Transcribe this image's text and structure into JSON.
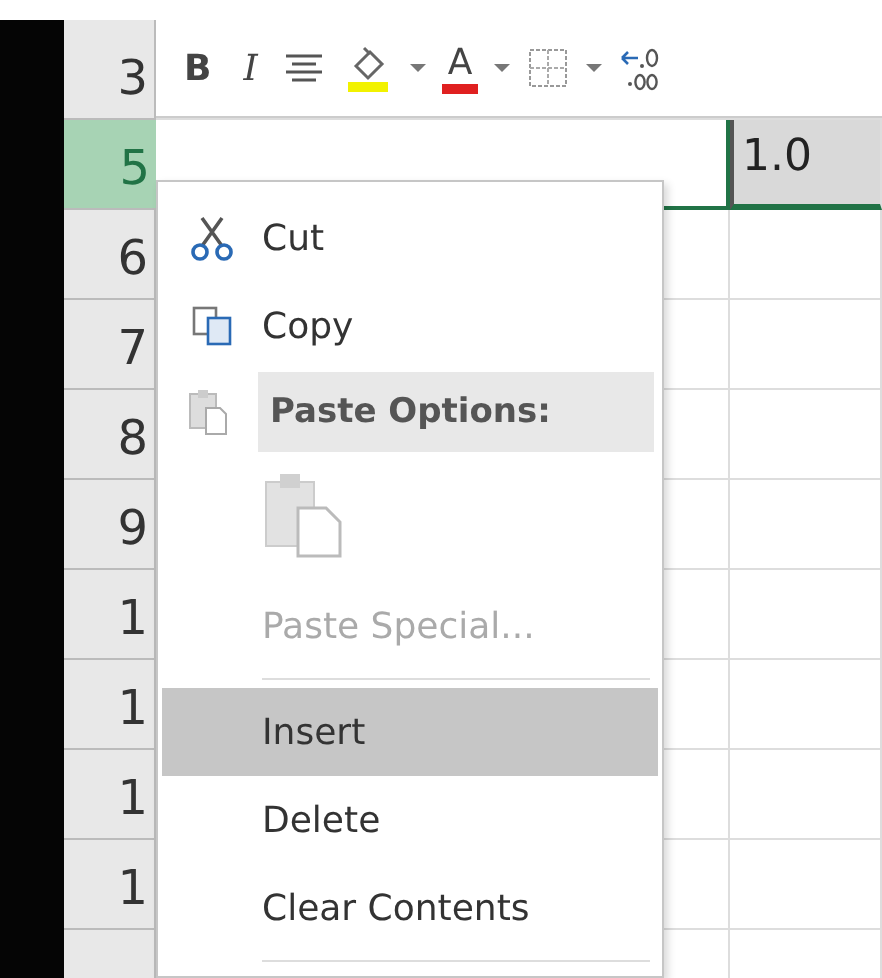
{
  "mini_toolbar": {
    "buttons": [
      {
        "kind": "bold",
        "label": "B"
      },
      {
        "kind": "italic",
        "label": "I"
      },
      {
        "kind": "align"
      },
      {
        "kind": "fill",
        "color": "#f2f200"
      },
      {
        "kind": "dropdown"
      },
      {
        "kind": "font-color",
        "label": "A",
        "color": "#e02020"
      },
      {
        "kind": "dropdown"
      },
      {
        "kind": "borders"
      },
      {
        "kind": "dropdown"
      },
      {
        "kind": "decimal"
      }
    ]
  },
  "rows": [
    {
      "header": "3",
      "selected": false,
      "cells": []
    },
    {
      "header": "5",
      "selected": true,
      "cells": [
        "",
        "1.0"
      ]
    },
    {
      "header": "6",
      "selected": false,
      "cells": []
    },
    {
      "header": "7",
      "selected": false,
      "cells": []
    },
    {
      "header": "8",
      "selected": false,
      "cells": []
    },
    {
      "header": "9",
      "selected": false,
      "cells": []
    },
    {
      "header": "1",
      "selected": false,
      "cells": []
    },
    {
      "header": "1",
      "selected": false,
      "cells": []
    },
    {
      "header": "1",
      "selected": false,
      "cells": []
    },
    {
      "header": "1",
      "selected": false,
      "cells": []
    }
  ],
  "context_menu": {
    "items": [
      {
        "kind": "item",
        "label": "Cut",
        "disabled": false,
        "selected": false
      },
      {
        "kind": "item",
        "label": "Copy",
        "disabled": false,
        "selected": false
      },
      {
        "kind": "header",
        "label": "Paste Options:"
      },
      {
        "kind": "paste-option"
      },
      {
        "kind": "item",
        "label": "Paste Special...",
        "disabled": true,
        "selected": false
      },
      {
        "kind": "separator"
      },
      {
        "kind": "item",
        "label": "Insert",
        "disabled": false,
        "selected": true
      },
      {
        "kind": "item",
        "label": "Delete",
        "disabled": false,
        "selected": false
      },
      {
        "kind": "item",
        "label": "Clear Contents",
        "disabled": false,
        "selected": false
      },
      {
        "kind": "separator"
      }
    ]
  }
}
